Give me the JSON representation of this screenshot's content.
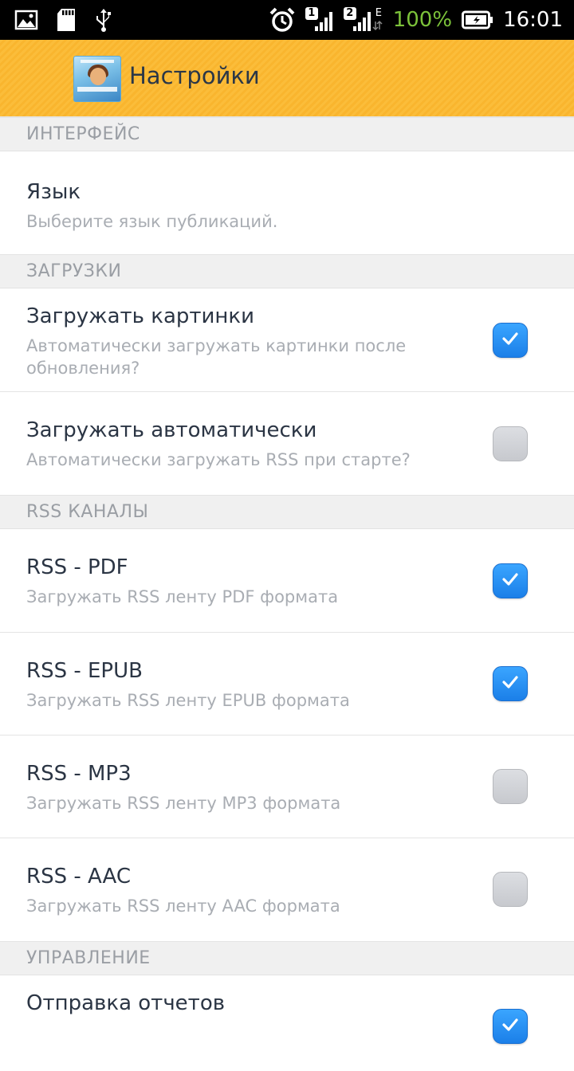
{
  "status_bar": {
    "battery_percent": "100%",
    "time": "16:01",
    "sim1": "1",
    "sim2": "2",
    "network_type": "E",
    "icons": [
      "gallery-icon",
      "sd-card-icon",
      "usb-icon",
      "alarm-icon",
      "signal-sim1-icon",
      "signal-sim2-icon",
      "battery-icon"
    ]
  },
  "action_bar": {
    "title": "Настройки",
    "accent_color": "#fbbd3a"
  },
  "sections": {
    "interface": {
      "header": "ИНТЕРФЕЙС"
    },
    "downloads": {
      "header": "ЗАГРУЗКИ"
    },
    "rss": {
      "header": "RSS КАНАЛЫ"
    },
    "control": {
      "header": "УПРАВЛЕНИЕ"
    }
  },
  "prefs": {
    "language": {
      "title": "Язык",
      "summary": "Выберите язык публикаций."
    },
    "load_images": {
      "title": "Загружать картинки",
      "summary": "Автоматически загружать картинки после обновления?",
      "checked": true
    },
    "auto_load": {
      "title": "Загружать автоматически",
      "summary": "Автоматически загружать RSS при старте?",
      "checked": false
    },
    "rss_pdf": {
      "title": "RSS - PDF",
      "summary": "Загружать RSS ленту PDF формата",
      "checked": true
    },
    "rss_epub": {
      "title": "RSS - EPUB",
      "summary": "Загружать RSS ленту EPUB формата",
      "checked": true
    },
    "rss_mp3": {
      "title": "RSS - MP3",
      "summary": "Загружать RSS ленту MP3 формата",
      "checked": false
    },
    "rss_aac": {
      "title": "RSS - AAC",
      "summary": "Загружать RSS ленту AAC формата",
      "checked": false
    },
    "send_reports": {
      "title": "Отправка отчетов",
      "checked": true
    }
  },
  "colors": {
    "checkbox_on": "#1b7fe8",
    "checkbox_off": "#c7c9ce",
    "battery_text": "#7cc23a"
  }
}
